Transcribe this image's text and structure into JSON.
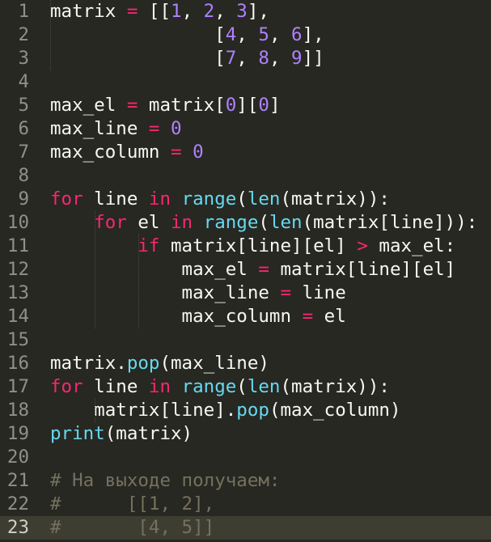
{
  "editor": {
    "colors": {
      "background": "#272822",
      "current_line": "#3e3d32",
      "gutter_text": "#8f908a",
      "default_text": "#f8f8f2",
      "keyword": "#f92672",
      "builtin": "#66d9ef",
      "number": "#ae81ff",
      "comment": "#75715e"
    },
    "current_line": 23,
    "lines": [
      {
        "num": "1",
        "tokens": [
          [
            "id",
            "matrix"
          ],
          [
            "pn",
            " "
          ],
          [
            "op",
            "="
          ],
          [
            "pn",
            " [["
          ],
          [
            "num",
            "1"
          ],
          [
            "pn",
            ", "
          ],
          [
            "num",
            "2"
          ],
          [
            "pn",
            ", "
          ],
          [
            "num",
            "3"
          ],
          [
            "pn",
            "],"
          ]
        ]
      },
      {
        "num": "2",
        "tokens": [
          [
            "pn",
            "               ["
          ],
          [
            "num",
            "4"
          ],
          [
            "pn",
            ", "
          ],
          [
            "num",
            "5"
          ],
          [
            "pn",
            ", "
          ],
          [
            "num",
            "6"
          ],
          [
            "pn",
            "],"
          ]
        ]
      },
      {
        "num": "3",
        "tokens": [
          [
            "pn",
            "               ["
          ],
          [
            "num",
            "7"
          ],
          [
            "pn",
            ", "
          ],
          [
            "num",
            "8"
          ],
          [
            "pn",
            ", "
          ],
          [
            "num",
            "9"
          ],
          [
            "pn",
            "]]"
          ]
        ]
      },
      {
        "num": "4",
        "tokens": []
      },
      {
        "num": "5",
        "tokens": [
          [
            "id",
            "max_el"
          ],
          [
            "pn",
            " "
          ],
          [
            "op",
            "="
          ],
          [
            "pn",
            " matrix["
          ],
          [
            "num",
            "0"
          ],
          [
            "pn",
            "]["
          ],
          [
            "num",
            "0"
          ],
          [
            "pn",
            "]"
          ]
        ]
      },
      {
        "num": "6",
        "tokens": [
          [
            "id",
            "max_line"
          ],
          [
            "pn",
            " "
          ],
          [
            "op",
            "="
          ],
          [
            "pn",
            " "
          ],
          [
            "num",
            "0"
          ]
        ]
      },
      {
        "num": "7",
        "tokens": [
          [
            "id",
            "max_column"
          ],
          [
            "pn",
            " "
          ],
          [
            "op",
            "="
          ],
          [
            "pn",
            " "
          ],
          [
            "num",
            "0"
          ]
        ]
      },
      {
        "num": "8",
        "tokens": []
      },
      {
        "num": "9",
        "tokens": [
          [
            "kw",
            "for"
          ],
          [
            "pn",
            " line "
          ],
          [
            "kw",
            "in"
          ],
          [
            "pn",
            " "
          ],
          [
            "fn",
            "range"
          ],
          [
            "pn",
            "("
          ],
          [
            "fn",
            "len"
          ],
          [
            "pn",
            "(matrix)):"
          ]
        ]
      },
      {
        "num": "10",
        "tokens": [
          [
            "pn",
            "    "
          ],
          [
            "kw",
            "for"
          ],
          [
            "pn",
            " el "
          ],
          [
            "kw",
            "in"
          ],
          [
            "pn",
            " "
          ],
          [
            "fn",
            "range"
          ],
          [
            "pn",
            "("
          ],
          [
            "fn",
            "len"
          ],
          [
            "pn",
            "(matrix[line])):"
          ]
        ]
      },
      {
        "num": "11",
        "tokens": [
          [
            "pn",
            "        "
          ],
          [
            "kw",
            "if"
          ],
          [
            "pn",
            " matrix[line][el] "
          ],
          [
            "op",
            ">"
          ],
          [
            "pn",
            " max_el:"
          ]
        ]
      },
      {
        "num": "12",
        "tokens": [
          [
            "pn",
            "            max_el "
          ],
          [
            "op",
            "="
          ],
          [
            "pn",
            " matrix[line][el]"
          ]
        ]
      },
      {
        "num": "13",
        "tokens": [
          [
            "pn",
            "            max_line "
          ],
          [
            "op",
            "="
          ],
          [
            "pn",
            " line"
          ]
        ]
      },
      {
        "num": "14",
        "tokens": [
          [
            "pn",
            "            max_column "
          ],
          [
            "op",
            "="
          ],
          [
            "pn",
            " el"
          ]
        ]
      },
      {
        "num": "15",
        "tokens": []
      },
      {
        "num": "16",
        "tokens": [
          [
            "pn",
            "matrix."
          ],
          [
            "fn",
            "pop"
          ],
          [
            "pn",
            "(max_line)"
          ]
        ]
      },
      {
        "num": "17",
        "tokens": [
          [
            "kw",
            "for"
          ],
          [
            "pn",
            " line "
          ],
          [
            "kw",
            "in"
          ],
          [
            "pn",
            " "
          ],
          [
            "fn",
            "range"
          ],
          [
            "pn",
            "("
          ],
          [
            "fn",
            "len"
          ],
          [
            "pn",
            "(matrix)):"
          ]
        ]
      },
      {
        "num": "18",
        "tokens": [
          [
            "pn",
            "    matrix[line]."
          ],
          [
            "fn",
            "pop"
          ],
          [
            "pn",
            "(max_column)"
          ]
        ]
      },
      {
        "num": "19",
        "tokens": [
          [
            "fn",
            "print"
          ],
          [
            "pn",
            "(matrix)"
          ]
        ]
      },
      {
        "num": "20",
        "tokens": []
      },
      {
        "num": "21",
        "tokens": [
          [
            "cm",
            "# На выходе получаем:"
          ]
        ]
      },
      {
        "num": "22",
        "tokens": [
          [
            "cm",
            "#      [[1, 2],"
          ]
        ]
      },
      {
        "num": "23",
        "tokens": [
          [
            "cm",
            "#       [4, 5]]"
          ]
        ]
      }
    ]
  }
}
